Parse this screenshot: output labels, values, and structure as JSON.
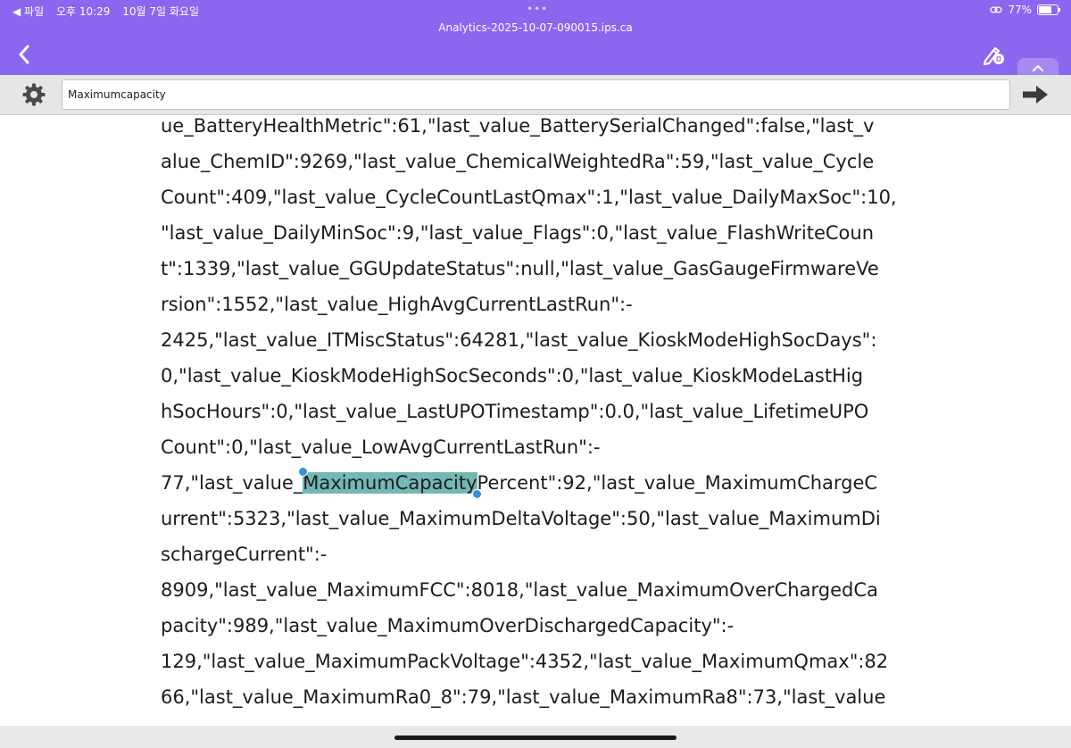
{
  "status_bar": {
    "back_app": "◀ 파일",
    "time": "오후 10:29",
    "date": "10월 7일 화요일",
    "battery": "77%",
    "battery_level": 0.77
  },
  "header": {
    "file_title": "Analytics-2025-10-07-090015.ips.ca"
  },
  "search": {
    "query": "Maximumcapacity"
  },
  "icons": {
    "back": "chevron-left-icon",
    "edit": "pencil-edit-icon",
    "collapse": "chevron-up-icon",
    "settings": "gear-icon",
    "go": "arrow-right-icon"
  },
  "colors": {
    "header": "#8b67f0",
    "highlight": "#73b8b5",
    "selection_handle": "#3a8fd6"
  },
  "content": {
    "lines": [
      "ue_BatteryHealthMetric\":61,\"last_value_BatterySerialChanged\":false,\"last_v",
      "alue_ChemID\":9269,\"last_value_ChemicalWeightedRa\":59,\"last_value_Cycle",
      "Count\":409,\"last_value_CycleCountLastQmax\":1,\"last_value_DailyMaxSoc\":10,",
      "\"last_value_DailyMinSoc\":9,\"last_value_Flags\":0,\"last_value_FlashWriteCoun",
      "t\":1339,\"last_value_GGUpdateStatus\":null,\"last_value_GasGaugeFirmwareVe",
      "rsion\":1552,\"last_value_HighAvgCurrentLastRun\":-",
      "2425,\"last_value_ITMiscStatus\":64281,\"last_value_KioskModeHighSocDays\":",
      "0,\"last_value_KioskModeHighSocSeconds\":0,\"last_value_KioskModeLastHig",
      "hSocHours\":0,\"last_value_LastUPOTimestamp\":0.0,\"last_value_LifetimeUPO",
      "Count\":0,\"last_value_LowAvgCurrentLastRun\":-"
    ],
    "highlight_line": {
      "before": "77,\"last_value_",
      "match": "MaximumCapacity",
      "after": "Percent\":92,\"last_value_MaximumChargeC"
    },
    "lines_after": [
      "urrent\":5323,\"last_value_MaximumDeltaVoltage\":50,\"last_value_MaximumDi",
      "schargeCurrent\":-",
      "8909,\"last_value_MaximumFCC\":8018,\"last_value_MaximumOverChargedCa",
      "pacity\":989,\"last_value_MaximumOverDischargedCapacity\":-",
      "129,\"last_value_MaximumPackVoltage\":4352,\"last_value_MaximumQmax\":82",
      "66,\"last_value_MaximumRa0_8\":79,\"last_value_MaximumRa8\":73,\"last_value"
    ]
  }
}
